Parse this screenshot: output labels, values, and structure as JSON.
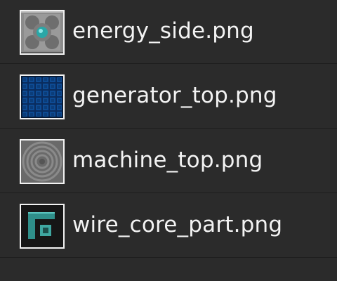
{
  "files": [
    {
      "name": "energy_side.png",
      "icon": "energy-side-texture-icon"
    },
    {
      "name": "generator_top.png",
      "icon": "generator-top-texture-icon"
    },
    {
      "name": "machine_top.png",
      "icon": "machine-top-texture-icon"
    },
    {
      "name": "wire_core_part.png",
      "icon": "wire-core-part-texture-icon"
    }
  ],
  "colors": {
    "background": "#2b2b2b",
    "divider": "#1e1e1e",
    "text": "#f3f3f3",
    "thumb_border": "#f2f2f2",
    "energy_accent": "#3fc0c0",
    "generator_blue": "#0b3d7a",
    "wire_teal": "#2f8f8a"
  }
}
